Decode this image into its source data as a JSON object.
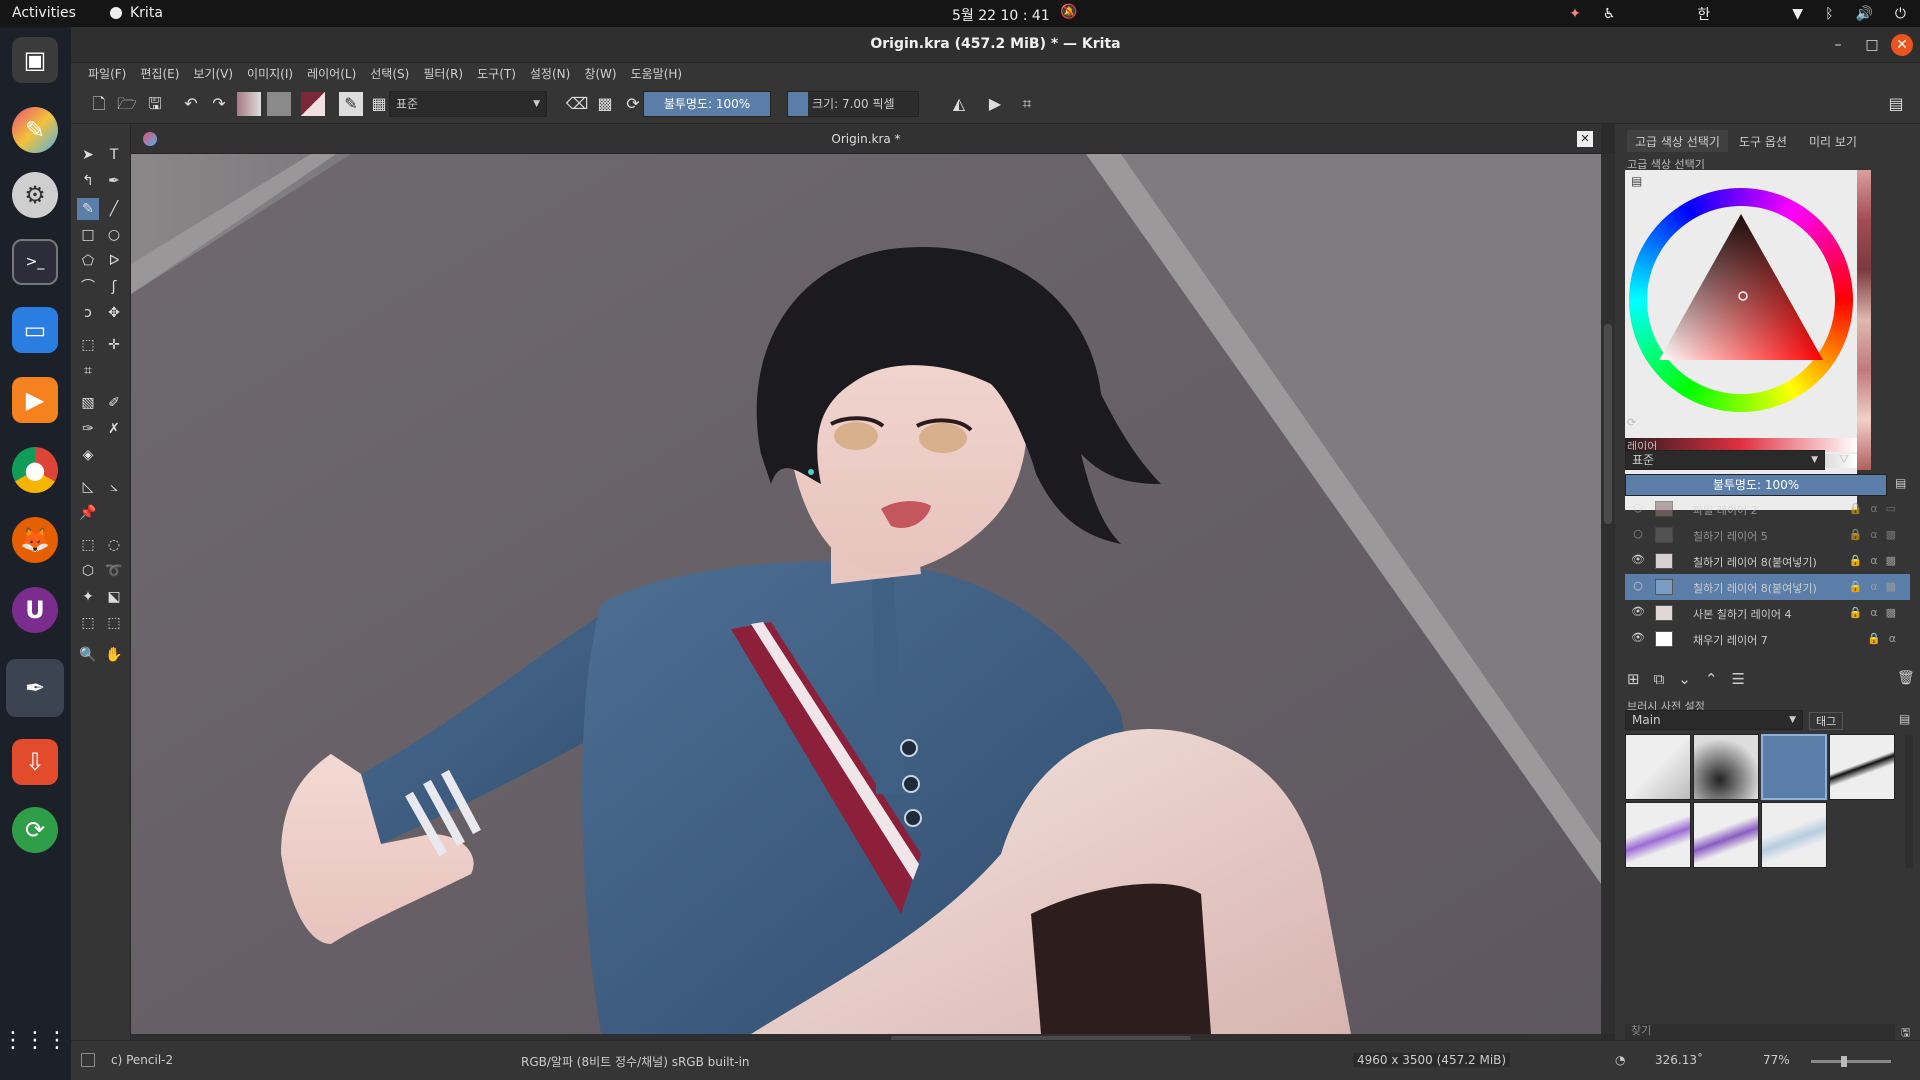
{
  "system": {
    "activities": "Activities",
    "app_name": "Krita",
    "clock": "5월 22  10 : 41",
    "ime": "한"
  },
  "window": {
    "title": "Origin.kra (457.2 MiB)  * — Krita"
  },
  "menu": [
    "파일(F)",
    "편집(E)",
    "보기(V)",
    "이미지(I)",
    "레이어(L)",
    "선택(S)",
    "필터(R)",
    "도구(T)",
    "설정(N)",
    "창(W)",
    "도움말(H)"
  ],
  "toolbar": {
    "blend_mode": "표준",
    "opacity": "불투명도: 100%",
    "size": "크기: 7.00 픽셀"
  },
  "document": {
    "tab_title": "Origin.kra *"
  },
  "right_panel": {
    "tabs": [
      "고급 색상 선택기",
      "도구 옵션",
      "미리 보기"
    ],
    "color_selector_title": "고급 색상 선택기",
    "layers_title": "레이어",
    "layer_blend_mode": "표준",
    "layer_opacity": "불투명도:  100%",
    "layers": [
      {
        "name": "파일 레이어 2",
        "visible": false
      },
      {
        "name": "칠하기 레이어 5",
        "visible": false
      },
      {
        "name": "칠하기 레이어 8(붙여넣기)",
        "visible": true
      },
      {
        "name": "칠하기 레이어 8(붙여넣기)",
        "visible": false,
        "selected": true
      },
      {
        "name": "사본 칠하기 레이어 4",
        "visible": true
      },
      {
        "name": "채우기 레이어 7",
        "visible": true
      }
    ],
    "brush_presets_title": "브러시 사전 설정",
    "brush_tag": "Main",
    "tag_button": "태그",
    "search_placeholder": "찾기"
  },
  "status": {
    "brush": "c) Pencil-2",
    "color_space": "RGB/알파 (8비트 정수/채널)  sRGB built-in",
    "image_size": "4960 x 3500 (457.2 MiB)",
    "rotation": "326.13˚",
    "zoom": "77%"
  },
  "colors": {
    "accent": "#5a7ea8",
    "canvas_bg": "#6b6468"
  }
}
